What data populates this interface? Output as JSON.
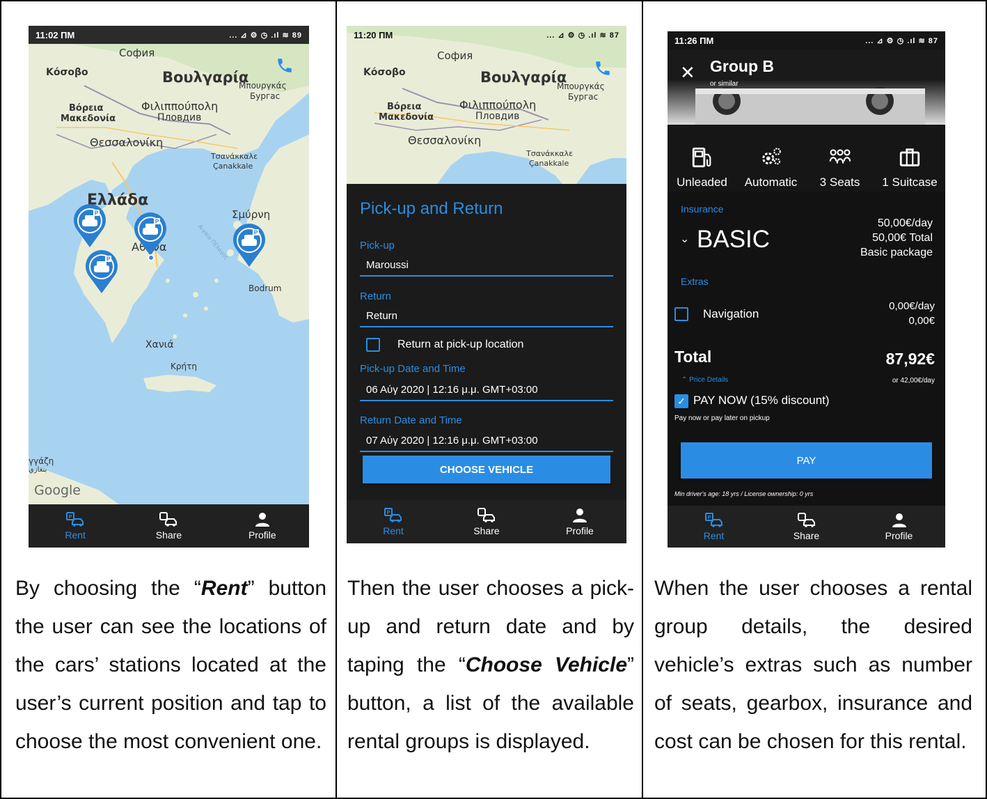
{
  "colors": {
    "accent": "#2a8de3",
    "dark_bg": "#121212",
    "nav_bg": "#212121"
  },
  "screen1": {
    "status_time": "11:02 ПМ",
    "status_icons": "... ⊿ ⚙ ◷ .ıl ≋ 89",
    "map_labels": {
      "sofia_top": "София",
      "kosovo": "Κόσοβο",
      "bulgaria": "Βουλγαρία",
      "burgas_gr": "Μπουργκάς",
      "burgas": "Бургас",
      "north_mac_1": "Βόρεια",
      "north_mac_2": "Μακεδονία",
      "plovdiv_gr": "Φιλιππούπολη",
      "plovdiv": "Пловдив",
      "thessaloniki": "Θεσσαλονίκη",
      "canakkale_gr": "Τσανάκκαλε",
      "canakkale": "Çanakkale",
      "greece": "Ελλάδα",
      "smyrna": "Σμύρνη",
      "athens": "Αθήνα",
      "bodrum": "Bodrum",
      "chania": "Χανιά",
      "crete": "Κρήτη",
      "benghazi": "γγάζη",
      "benghazi_ar": "بنغازي",
      "google": "Google",
      "aegean": "Αιγαίο Πέλαγος"
    }
  },
  "screen2": {
    "status_time": "11:20 ПМ",
    "status_icons": "... ⊿ ⚙ ◷ .ıl ≋ 87",
    "title": "Pick-up and Return",
    "pickup_label": "Pick-up",
    "pickup_value": "Maroussi",
    "return_label": "Return",
    "return_value": "Return",
    "same_location_label": "Return at pick-up location",
    "pickup_dt_label": "Pick-up Date and Time",
    "pickup_dt_value": "06 Αύγ 2020 | 12:16 μ.μ. GMT+03:00",
    "return_dt_label": "Return Date and Time",
    "return_dt_value": "07 Αύγ 2020 | 12:16 μ.μ. GMT+03:00",
    "choose_button": "CHOOSE VEHICLE"
  },
  "screen3": {
    "status_time": "11:26 ПМ",
    "status_icons": "... ⊿ ⚙ ◷ .ıl ≋ 87",
    "group_title": "Group B",
    "group_sub": "or similar",
    "features": [
      "Unleaded",
      "Automatic",
      "3 Seats",
      "1 Suitcase"
    ],
    "insurance_label": "Insurance",
    "insurance_name": "BASIC",
    "insurance_price_day": "50,00€/day",
    "insurance_price_total": "50,00€ Total",
    "insurance_desc": "Basic package",
    "extras_label": "Extras",
    "extra_name": "Navigation",
    "extra_price_day": "0,00€/day",
    "extra_price_total": "0,00€",
    "total_label": "Total",
    "total_value": "87,92€",
    "price_details": "Price Details",
    "per_day": "or 42,00€/day",
    "pay_now_label": "PAY NOW (15% discount)",
    "pay_note": "Pay now or pay later on pickup",
    "pay_button": "PAY",
    "min_age": "Min driver's age: 18 yrs / License ownership: 0 yrs"
  },
  "nav": {
    "rent": "Rent",
    "share": "Share",
    "profile": "Profile"
  },
  "captions": {
    "c1_pre": "By choosing the “",
    "c1_bold": "Rent",
    "c1_post": "” button the user can see the locations of the cars’ stations located at the user’s current position and tap to choose the most convenient one.",
    "c2_pre": "Then the user chooses a pick-up and return date and by taping the “",
    "c2_bold": "Choose Vehicle",
    "c2_post": "” button, a list of the available rental groups is displayed.",
    "c3": "When the user chooses a rental group details, the desired vehicle’s extras such as number of seats, gearbox, insurance and cost can be chosen for this rental."
  }
}
